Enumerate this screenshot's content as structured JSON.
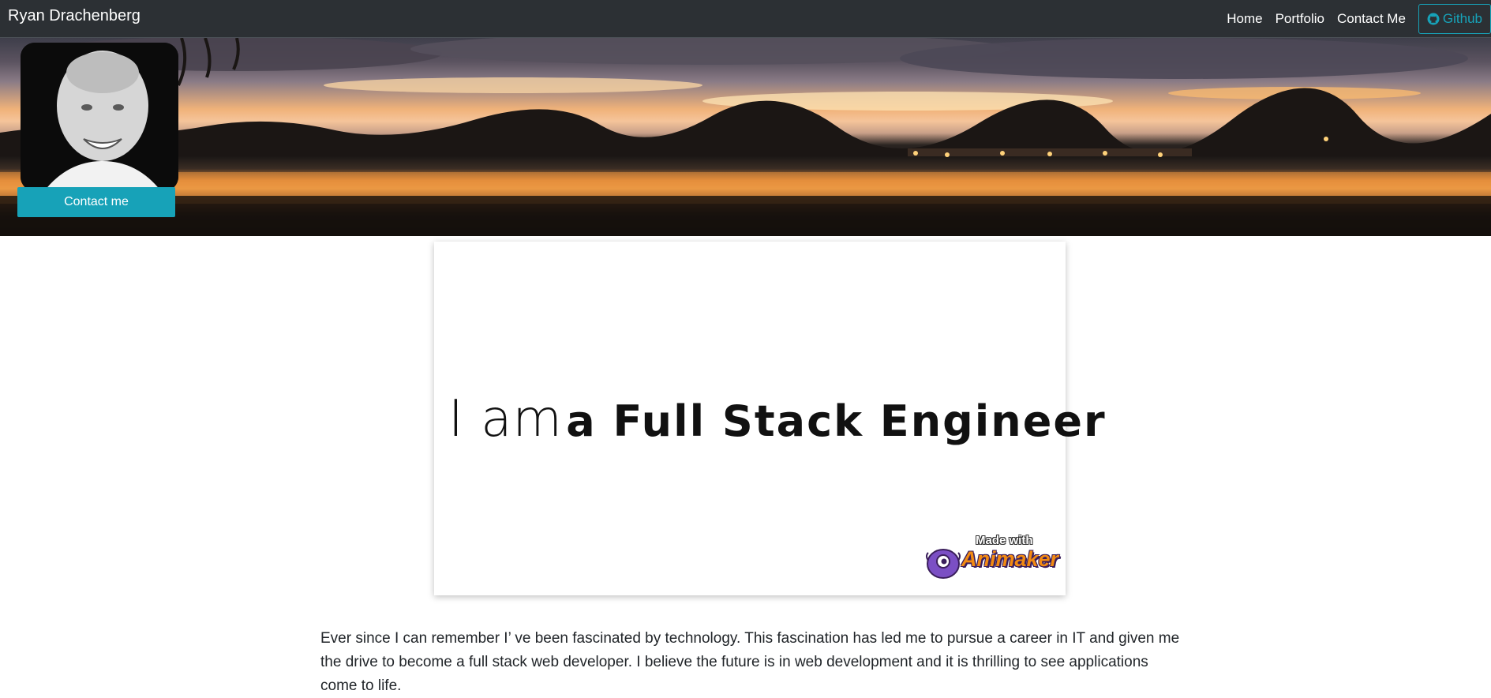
{
  "navbar": {
    "brand": "Ryan Drachenberg",
    "links": [
      "Home",
      "Portfolio",
      "Contact Me"
    ],
    "github_label": "Github",
    "github_icon": "github-icon",
    "background": "#2c3034",
    "accent": "#17a2b8"
  },
  "hero": {
    "image": "sunset-lake-banner",
    "profile_image": "profile-photo",
    "contact_button": "Contact me"
  },
  "video": {
    "lead": "I am",
    "strong": "a Full Stack Engineer",
    "badge_made_with": "Made with",
    "badge_brand": "Animaker"
  },
  "bio": {
    "text": "Ever since I can remember I’ ve been fascinated by technology. This fascination has led me to pursue a career in IT and given me the drive to become a full stack web developer. I believe the future is in web development and it is thrilling to see applications come to life."
  }
}
